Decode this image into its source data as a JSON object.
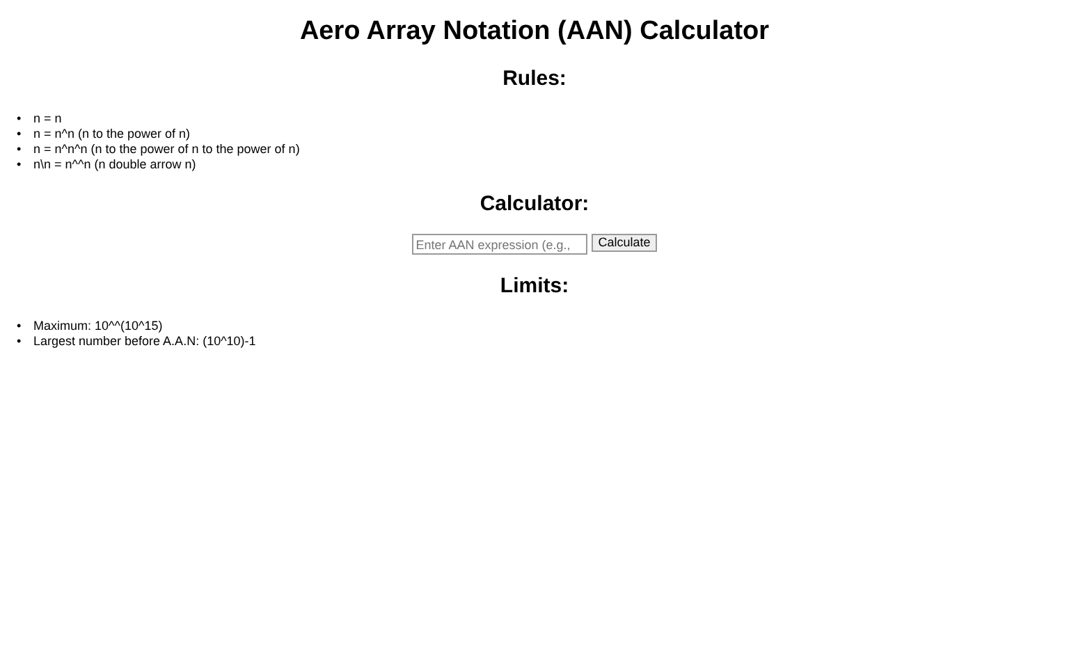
{
  "title": "Aero Array Notation (AAN) Calculator",
  "rules": {
    "heading": "Rules:",
    "marker": "•",
    "items": [
      "n = n",
      "n = n^n (n to the power of n)",
      "n = n^n^n (n to the power of n to the power of n)",
      "n\\n = n^^n (n double arrow n)"
    ]
  },
  "calculator": {
    "heading": "Calculator:",
    "input": {
      "placeholder": "Enter AAN expression (e.g.,"
    },
    "button": "Calculate"
  },
  "limits": {
    "heading": "Limits:",
    "marker": "•",
    "items": [
      "Maximum: 10^^(10^15)",
      "Largest number before A.A.N: (10^10)-1"
    ]
  }
}
